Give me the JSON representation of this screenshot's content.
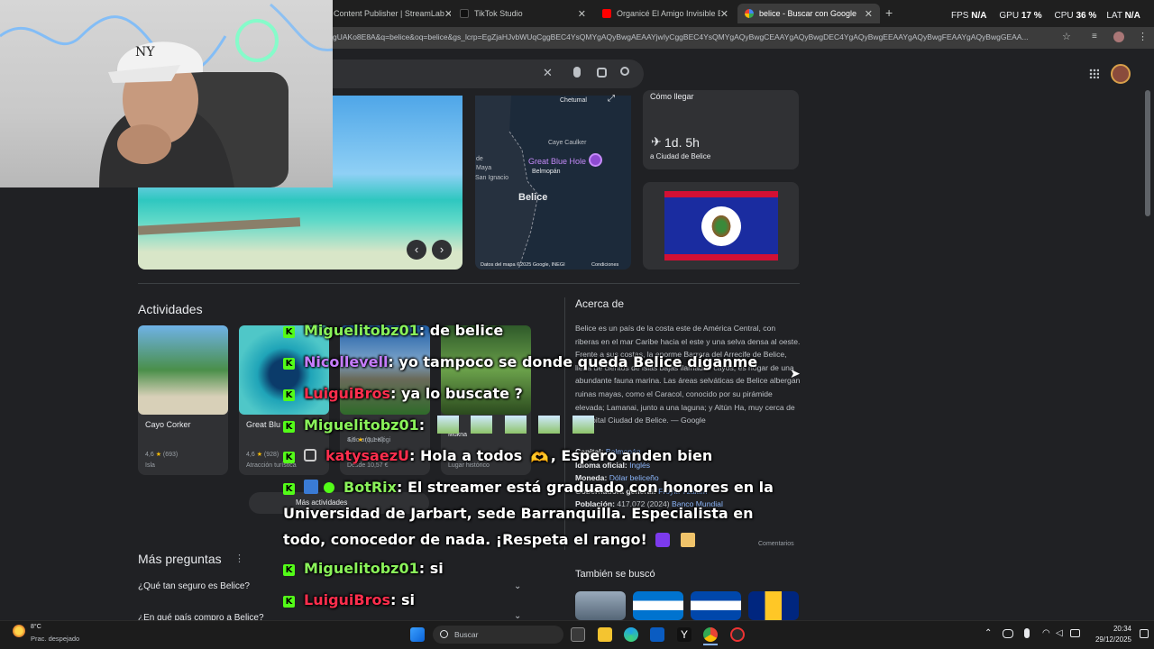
{
  "tabs": [
    {
      "label": "Content Publisher | StreamLab",
      "active": false
    },
    {
      "label": "TikTok Studio",
      "active": false
    },
    {
      "label": "Organicé El Amigo Invisible En",
      "active": false
    },
    {
      "label": "belice - Buscar con Google",
      "active": true
    }
  ],
  "perf": {
    "fps_label": "FPS",
    "fps_value": "N/A",
    "gpu_label": "GPU",
    "gpu_value": "17 %",
    "cpu_label": "CPU",
    "cpu_value": "36 %",
    "lat_label": "LAT",
    "lat_value": "N/A"
  },
  "url": "gUAKo8E8A&q=belice&oq=belice&gs_lcrp=EgZjaHJvbWUqCggBEC4YsQMYgAQyBwgAEAAYjwIyCggBEC4YsQMYgAQyBwgCEAAYgAQyBwgDEC4YgAQyBwgEEAAYgAQyBwgFEAAYgAQyBwgGEAA...",
  "map": {
    "city_top": "Chetumal",
    "caye": "Caye Caulker",
    "maya": "de\nMaya",
    "hole": "Great Blue Hole",
    "belmopan": "Belmopán",
    "ignacio": "San Ignacio",
    "country": "Belice",
    "attribution": "Datos del mapa ©2025 Google, INEGI",
    "terms": "Condiciones"
  },
  "travel": {
    "header": "Cómo llegar",
    "time": "1d. 5h",
    "dest": "a Ciudad de Belice"
  },
  "activities": {
    "title": "Actividades",
    "items": [
      {
        "name": "Cayo Corker",
        "rating": "4,6",
        "reviews": "(693)",
        "type": "Isla"
      },
      {
        "name": "Great Blu",
        "rating": "4,6",
        "reviews": "(928)",
        "type": "Atracción turística"
      },
      {
        "name": "",
        "rating": "4,9",
        "reviews": "(3,1 K)",
        "type": "Desde 10,57 €",
        "extra": "Sitio arqueológi"
      },
      {
        "name": "Mukna",
        "rating": "",
        "reviews": "",
        "type": "Lugar histórico"
      }
    ],
    "more": "Más actividades"
  },
  "about": {
    "title": "Acerca de",
    "text": "Belice es un país de la costa este de América Central, con riberas en el mar Caribe hacia el este y una selva densa al oeste. Frente a sus costas, la enorme Barrera del Arrecife de Belice, llena de cientos de islas bajas llamadas cayos, es hogar de una abundante fauna marina. Las áreas selváticas de Belice albergan ruinas mayas, como el Caracol, conocido por su pirámide elevada; Lamanai, junto a una laguna; y Altún Ha, muy cerca de la capital Ciudad de Belice. — Google",
    "facts": [
      {
        "k": "Capital:",
        "v": "Belmopán"
      },
      {
        "k": "Idioma oficial:",
        "v": "Inglés"
      },
      {
        "k": "Moneda:",
        "v": "Dólar beliceño"
      },
      {
        "k": "Gobernadora general:",
        "v": "Froyla Tzalam"
      },
      {
        "k": "Población:",
        "v": "417.072 (2024)",
        "link": "Banco Mundial"
      }
    ],
    "comments": "Comentarios"
  },
  "also": {
    "title": "También se buscó"
  },
  "faq": {
    "title": "Más preguntas",
    "q1": "¿Qué tan seguro es Belice?",
    "q2": "¿En qué país compro a Belice?"
  },
  "chat": [
    {
      "user": "Miguelitobz01",
      "color": "green",
      "msg": ": de belice"
    },
    {
      "user": "Nicollevell",
      "color": "purple",
      "msg": ": yo tampoco se donde queda Belice díganme"
    },
    {
      "user": "LuiguiBros",
      "color": "red",
      "msg": ": ya lo buscate ?"
    },
    {
      "user": "Miguelitobz01",
      "color": "green",
      "msg": ":"
    },
    {
      "user": "katysaezU",
      "color": "red",
      "msg": ": Hola a todos",
      "msg2": ", Espero anden bien"
    },
    {
      "user": "BotRix",
      "color": "green",
      "msg": ": El streamer está graduado con honores en la"
    },
    {
      "line": "Universidad de Jarbart, sede Barranquilla. Especialista en"
    },
    {
      "line": "todo, conocedor de nada. ¡Respeta el rango!"
    },
    {
      "user": "Miguelitobz01",
      "color": "green",
      "msg": ": si"
    },
    {
      "user": "LuiguiBros",
      "color": "red",
      "msg": ": si"
    }
  ],
  "taskbar": {
    "weather_temp": "8°C",
    "weather_desc": "Prac. despejado",
    "search": "Buscar",
    "time": "20:34",
    "date": "29/12/2025"
  },
  "colors": {
    "accent_green": "#53fc18",
    "belize_blue": "#1a2ca0",
    "belize_red": "#d21034"
  }
}
